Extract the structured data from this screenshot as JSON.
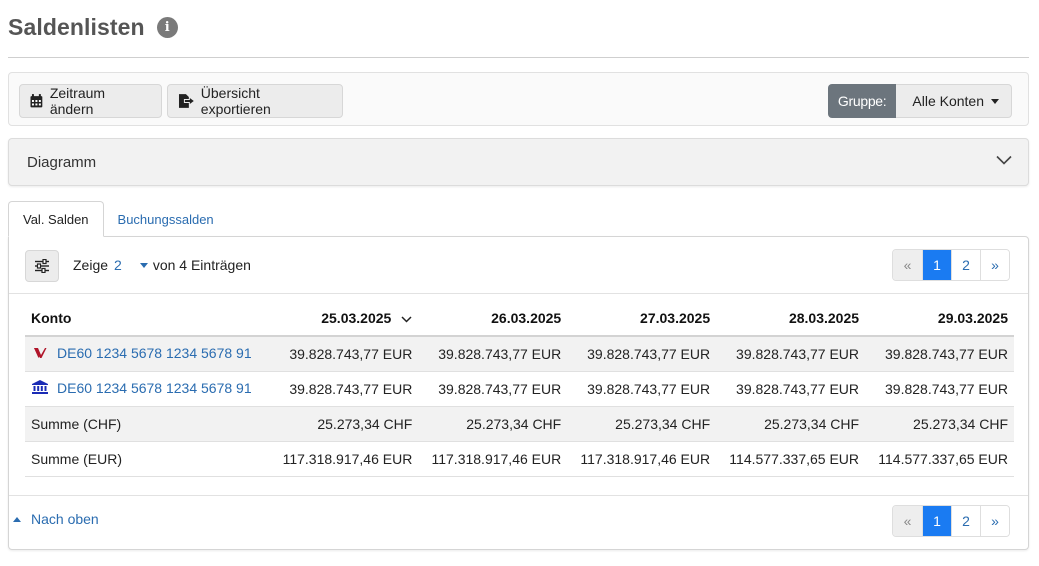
{
  "page": {
    "title": "Saldenlisten"
  },
  "toolbar": {
    "zeitraum_label": "Zeitraum ändern",
    "export_label": "Übersicht exportieren",
    "group_label": "Gruppe:",
    "group_value": "Alle Konten"
  },
  "accordion": {
    "title": "Diagramm"
  },
  "tabs": [
    {
      "label": "Val. Salden",
      "active": true
    },
    {
      "label": "Buchungssalden",
      "active": false
    }
  ],
  "list_controls": {
    "show_prefix": "Zeige",
    "show_count": "2",
    "show_suffix": "von 4 Einträgen"
  },
  "pagination": {
    "prev": "«",
    "pages": [
      "1",
      "2"
    ],
    "current": "1",
    "next": "»"
  },
  "table": {
    "headers": [
      "Konto",
      "25.03.2025",
      "26.03.2025",
      "27.03.2025",
      "28.03.2025",
      "29.03.2025"
    ],
    "rows": [
      {
        "konto": "DE60 1234 5678 1234 5678 91",
        "icon": "bank-logo-icon",
        "link": true,
        "values": [
          "39.828.743,77 EUR",
          "39.828.743,77 EUR",
          "39.828.743,77 EUR",
          "39.828.743,77 EUR",
          "39.828.743,77 EUR"
        ]
      },
      {
        "konto": "DE60 1234 5678 1234 5678 91",
        "icon": "bank-building-icon",
        "link": true,
        "values": [
          "39.828.743,77 EUR",
          "39.828.743,77 EUR",
          "39.828.743,77 EUR",
          "39.828.743,77 EUR",
          "39.828.743,77 EUR"
        ]
      },
      {
        "konto": "Summe (CHF)",
        "link": false,
        "values": [
          "25.273,34 CHF",
          "25.273,34 CHF",
          "25.273,34 CHF",
          "25.273,34 CHF",
          "25.273,34 CHF"
        ]
      },
      {
        "konto": "Summe (EUR)",
        "link": false,
        "values": [
          "117.318.917,46 EUR",
          "117.318.917,46 EUR",
          "117.318.917,46 EUR",
          "114.577.337,65 EUR",
          "114.577.337,65 EUR"
        ]
      }
    ]
  },
  "footer": {
    "back_to_top": "Nach oben"
  },
  "colors": {
    "accent": "#1a7bf2",
    "link": "#2a6cb0",
    "bank_logo": "#b0152a",
    "bank_building": "#1a2bb5"
  }
}
